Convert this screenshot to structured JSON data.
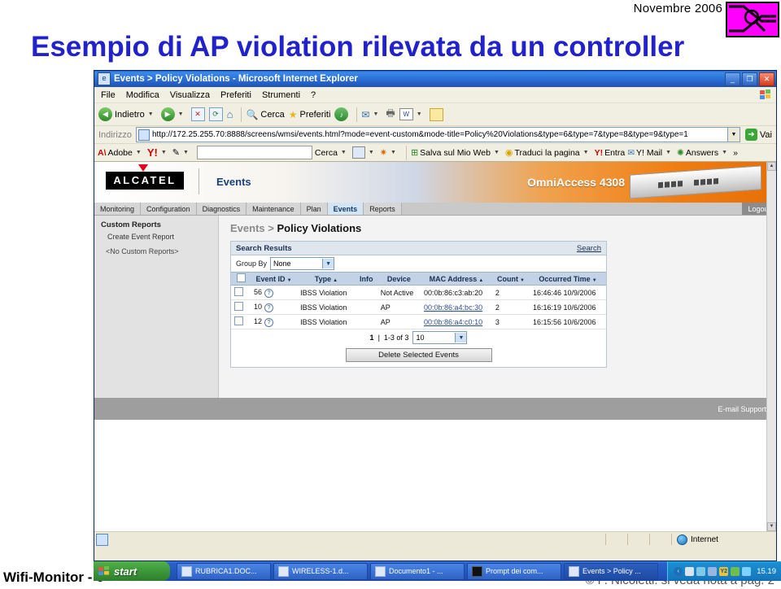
{
  "slide": {
    "date": "Novembre 2006",
    "title": "Esempio di AP violation rilevata da un controller",
    "footer_left": "Wifi-Monitor - 6",
    "footer_right": "© P. Nicoletti: si veda nota a  pag. 2",
    "title_color": "#2222cc",
    "logo_color": "#ff00ff"
  },
  "browser": {
    "title": "Events > Policy Violations - Microsoft Internet Explorer",
    "window_buttons": {
      "minimize": "_",
      "restore": "❐",
      "close": "✕"
    },
    "menu": [
      "File",
      "Modifica",
      "Visualizza",
      "Preferiti",
      "Strumenti",
      "?"
    ],
    "toolbar": {
      "back": "Indietro",
      "forward": "",
      "stop": "",
      "refresh": "",
      "home": "",
      "search": "Cerca",
      "favorites": "Preferiti",
      "media": "",
      "mail": "",
      "print": "",
      "edit": "",
      "notes": ""
    },
    "address": {
      "label": "Indirizzo",
      "url": "http://172.25.255.70:8888/screens/wmsi/events.html?mode=event-custom&mode-title=Policy%20Violations&type=6&type=7&type=8&type=9&type=1",
      "go": "Vai"
    },
    "yahoo_bar": {
      "adobe": "Adobe",
      "yahoo": "Y!",
      "search_value": "",
      "search_button": "Cerca",
      "save_web": "Salva sul Mio Web",
      "translate": "Traduci la pagina",
      "signin": "Entra",
      "mail": "Y! Mail",
      "answers": "Answers",
      "overflow": "»"
    },
    "status": {
      "zone": "Internet"
    }
  },
  "app": {
    "brand": "ALCATEL",
    "section": "Events",
    "model": "OmniAccess 4308",
    "tabs": [
      {
        "label": "Monitoring",
        "active": false
      },
      {
        "label": "Configuration",
        "active": false
      },
      {
        "label": "Diagnostics",
        "active": false
      },
      {
        "label": "Maintenance",
        "active": false
      },
      {
        "label": "Plan",
        "active": false
      },
      {
        "label": "Events",
        "active": true
      },
      {
        "label": "Reports",
        "active": false
      }
    ],
    "logout": "Logout",
    "sidebar": {
      "title": "Custom Reports",
      "create_link": "Create Event Report",
      "empty": "<No Custom Reports>"
    },
    "breadcrumb": {
      "parent": "Events",
      "sep": ">",
      "current": "Policy Violations"
    },
    "panel": {
      "heading": "Search Results",
      "search_link": "Search",
      "group_by_label": "Group By",
      "group_by_value": "None"
    },
    "table": {
      "columns": [
        {
          "label": "",
          "sort": ""
        },
        {
          "label": "Event ID",
          "sort": "▼"
        },
        {
          "label": "Type",
          "sort": "▲"
        },
        {
          "label": "Info",
          "sort": ""
        },
        {
          "label": "Device",
          "sort": ""
        },
        {
          "label": "MAC Address",
          "sort": "▲"
        },
        {
          "label": "Count",
          "sort": "▼"
        },
        {
          "label": "Occurred Time",
          "sort": "▼"
        }
      ],
      "rows": [
        {
          "event_id": "56",
          "type": "IBSS Violation",
          "info": "",
          "device": "Not Active",
          "mac": "00:0b:86:c3:ab:20",
          "mac_link": false,
          "count": "2",
          "occurred": "16:46:46 10/9/2006"
        },
        {
          "event_id": "10",
          "type": "IBSS Violation",
          "info": "",
          "device": "AP",
          "mac": "00:0b:86:a4:bc:30",
          "mac_link": true,
          "count": "2",
          "occurred": "16:16:19 10/6/2006"
        },
        {
          "event_id": "12",
          "type": "IBSS Violation",
          "info": "",
          "device": "AP",
          "mac": "00:0b:86:a4:c0:10",
          "mac_link": true,
          "count": "3",
          "occurred": "16:15:56 10/6/2006"
        }
      ]
    },
    "pager": {
      "page": "1",
      "sep": "|",
      "range": "1-3 of 3",
      "page_size": "10"
    },
    "delete_button": "Delete Selected Events",
    "email_support": "E-mail Support"
  },
  "taskbar": {
    "start": "start",
    "items": [
      {
        "label": "RUBRICA1.DOC...",
        "active": false,
        "icon": "word"
      },
      {
        "label": "WIRELESS-1.d...",
        "active": false,
        "icon": "word"
      },
      {
        "label": "Documento1 - ...",
        "active": false,
        "icon": "word"
      },
      {
        "label": "Prompt dei com...",
        "active": false,
        "icon": "cmd"
      },
      {
        "label": "Events > Policy ...",
        "active": true,
        "icon": "ie"
      }
    ],
    "clock": "15.19"
  }
}
